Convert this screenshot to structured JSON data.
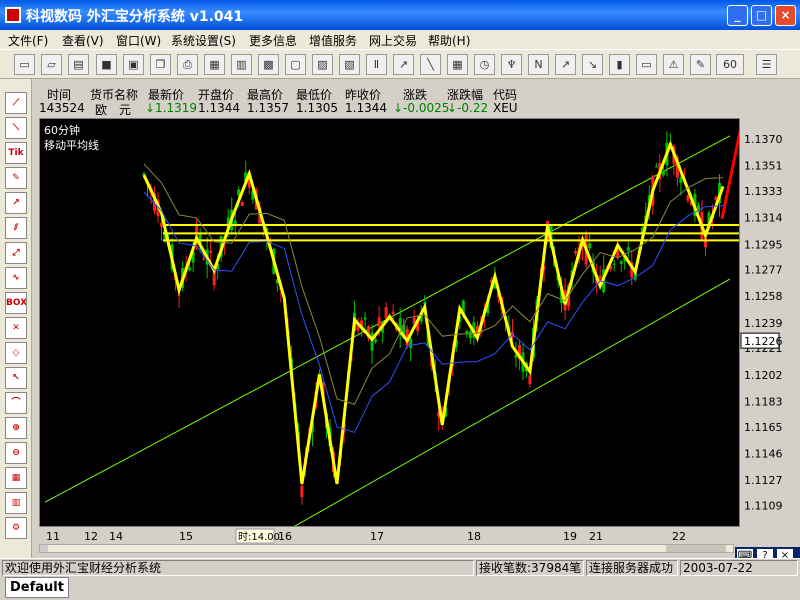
{
  "window": {
    "title": "科视数码 外汇宝分析系统 v1.041"
  },
  "menu": [
    "文件(F)",
    "查看(V)",
    "窗口(W)",
    "系统设置(S)",
    "更多信息",
    "增值服务",
    "网上交易",
    "帮助(H)"
  ],
  "toolbar": {
    "period_label": "60"
  },
  "left_tools": [
    "Tik",
    "BOX"
  ],
  "quote_header": {
    "time": "时间",
    "currency": "货币名称",
    "last": "最新价",
    "open": "开盘价",
    "high": "最高价",
    "low": "最低价",
    "prev": "昨收价",
    "change": "涨跌",
    "change_pct": "涨跌幅",
    "code": "代码"
  },
  "quote_row": {
    "time": "143524",
    "currency": "欧　元",
    "last": "↓1.1319",
    "open": "1.1344",
    "high": "1.1357",
    "low": "1.1305",
    "prev": "1.1344",
    "change": "↓-0.0025",
    "change_pct": "↓-0.22",
    "code": "XEU"
  },
  "chart_labels": {
    "period": "60分钟",
    "indicator": "移动平均线"
  },
  "chart_data": {
    "type": "line",
    "title": "",
    "xlabel": "",
    "ylabel": "",
    "ylim": [
      1.1095,
      1.1385
    ],
    "y_ticks": [
      "1.1370",
      "1.1351",
      "1.1333",
      "1.1314",
      "1.1295",
      "1.1277",
      "1.1258",
      "1.1239",
      "1.1221",
      "1.1202",
      "1.1183",
      "1.1165",
      "1.1146",
      "1.1127",
      "1.1109"
    ],
    "x_ticks": [
      "11",
      "12",
      "14",
      "15",
      "16",
      "17",
      "18",
      "19",
      "21",
      "22"
    ],
    "current_price": "1.1226",
    "cursor_label": "时:14.00",
    "colors": {
      "up": "#00c000",
      "down": "#ff2020",
      "zigzag": "#ffff00",
      "channel": "#7cfc00",
      "arrow": "#ff0000"
    },
    "series": [
      {
        "values": [
          1.1345,
          1.1318,
          1.1263,
          1.13,
          1.1277,
          1.1314,
          1.1346,
          1.1302,
          1.1257,
          1.1125,
          1.1203,
          1.1125,
          1.1242,
          1.1228,
          1.1244,
          1.1227,
          1.1251,
          1.1167,
          1.125,
          1.1229,
          1.1273,
          1.1223,
          1.1205,
          1.1309,
          1.1253,
          1.1299,
          1.1266,
          1.1295,
          1.1276,
          1.1334,
          1.1367,
          1.1335,
          1.1302,
          1.1337
        ]
      }
    ]
  },
  "status": {
    "welcome": "欢迎使用外汇宝财经分析系统",
    "count": "接收笔数:37984笔",
    "conn": "连接服务器成功",
    "date": "2003-07-22"
  },
  "tab": {
    "name": "Default"
  }
}
